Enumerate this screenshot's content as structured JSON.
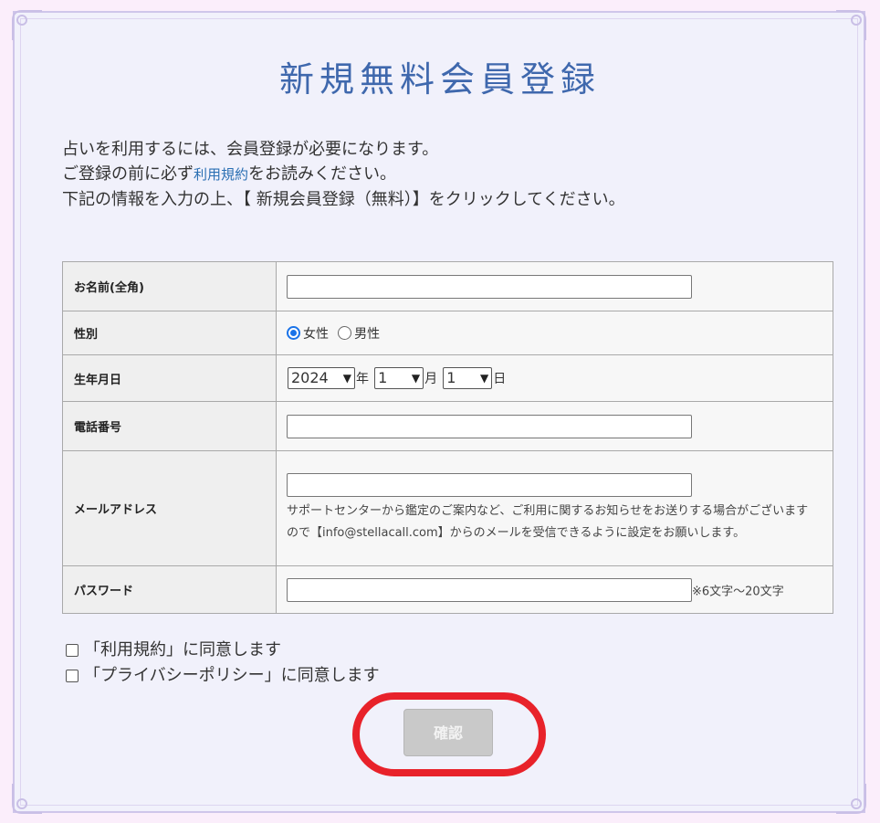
{
  "page": {
    "title": "新規無料会員登録",
    "intro_line1": "占いを利用するには、会員登録が必要になります。",
    "intro_line2_pre": "ご登録の前に必ず",
    "intro_line2_link": "利用規約",
    "intro_line2_post": "をお読みください。",
    "intro_line3": "下記の情報を入力の上、【 新規会員登録（無料）】をクリックしてください。"
  },
  "form": {
    "name_label": "お名前(全角)",
    "name_value": "",
    "gender_label": "性別",
    "gender_female": "女性",
    "gender_male": "男性",
    "gender_selected": "女性",
    "birth_label": "生年月日",
    "birth_year": "2024",
    "birth_year_unit": "年",
    "birth_month": "1",
    "birth_month_unit": "月",
    "birth_day": "1",
    "birth_day_unit": "日",
    "phone_label": "電話番号",
    "phone_value": "",
    "email_label": "メールアドレス",
    "email_value": "",
    "email_note": "サポートセンターから鑑定のご案内など、ご利用に関するお知らせをお送りする場合がございますので【info@stellacall.com】からのメールを受信できるように設定をお願いします。",
    "password_label": "パスワード",
    "password_value": "",
    "password_note": "※6文字～20文字"
  },
  "agreements": {
    "terms": "「利用規約」に同意します",
    "privacy": "「プライバシーポリシー」に同意します"
  },
  "confirm_label": "確認",
  "colors": {
    "title": "#3f68ad",
    "highlight": "#e8222a",
    "button_disabled": "#c9c9c9"
  }
}
